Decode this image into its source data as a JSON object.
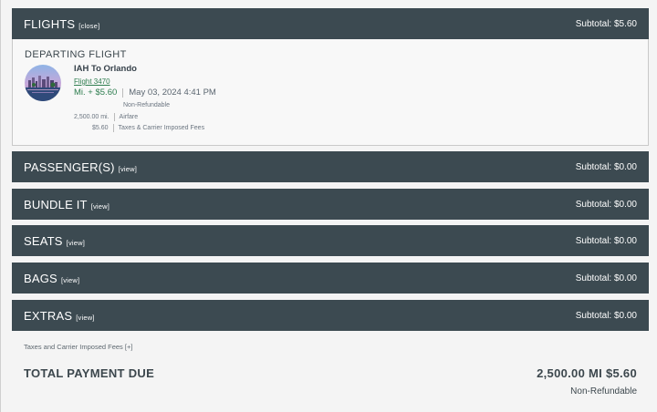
{
  "flights": {
    "title": "FLIGHTS",
    "toggle": "[close]",
    "subtotal": "Subtotal: $5.60",
    "departing_title": "DEPARTING  FLIGHT",
    "route": "IAH To Orlando",
    "flight_link": "Flight 3470",
    "price": "Mi. + $5.60",
    "date": "May 03, 2024 4:41 PM",
    "non_refundable": "Non-Refundable",
    "airfare_amount": "2,500.00 mi.",
    "airfare_label": "Airfare",
    "fees_amount": "$5.60",
    "fees_label": "Taxes & Carrier Imposed Fees"
  },
  "sections": {
    "passengers": {
      "title": "PASSENGER(S)",
      "toggle": "[view]",
      "subtotal": "Subtotal: $0.00"
    },
    "bundle": {
      "title": "BUNDLE IT",
      "toggle": "[view]",
      "subtotal": "Subtotal: $0.00"
    },
    "seats": {
      "title": "SEATS",
      "toggle": "[view]",
      "subtotal": "Subtotal: $0.00"
    },
    "bags": {
      "title": "BAGS",
      "toggle": "[view]",
      "subtotal": "Subtotal: $0.00"
    },
    "extras": {
      "title": "EXTRAS",
      "toggle": "[view]",
      "subtotal": "Subtotal: $0.00"
    }
  },
  "footer": {
    "tax_note": "Taxes and Carrier Imposed Fees",
    "tax_toggle": "[+]",
    "total_label": "TOTAL PAYMENT DUE",
    "total_amount": "2,500.00 MI $5.60",
    "non_refundable": "Non-Refundable"
  },
  "colors": {
    "bar": "#3c4a51",
    "link_green": "#2e7d4f",
    "text": "#3c474d"
  }
}
